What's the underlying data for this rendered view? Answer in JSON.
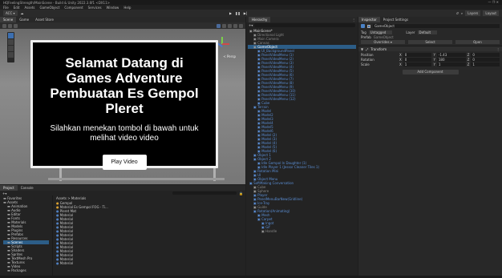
{
  "window": {
    "title": "HQFeelingStrength/MainScene - Build & Unity 2022.3.6f1 <DX11>"
  },
  "menu": [
    "File",
    "Edit",
    "Assets",
    "GameObject",
    "Component",
    "Services",
    "Window",
    "Help"
  ],
  "toolbar": {
    "account": "ACC ▾",
    "layers": "Layers",
    "layout": "Layout"
  },
  "scene_panel": {
    "tabs": [
      "Scene",
      "Game",
      "Asset Store"
    ],
    "persp_label": "< Persp"
  },
  "game_ui": {
    "title": "Selamat Datang di Games Adventure Pembuatan Es Gempol Pleret",
    "body": "Silahkan menekan tombol di bawah untuk melihat video video",
    "button": "Play Video"
  },
  "hierarchy": {
    "tab": "Hierarchy",
    "items": [
      {
        "label": "MainScene*",
        "indent": 0,
        "style": "bold"
      },
      {
        "label": "Directional Light",
        "indent": 1,
        "style": "dim"
      },
      {
        "label": "Main Camera",
        "indent": 1,
        "style": "dim"
      },
      {
        "label": "Canvas",
        "indent": 1,
        "style": "dim"
      },
      {
        "label": "GameObject",
        "indent": 1,
        "style": "sel"
      },
      {
        "label": "UI_BackgroundPanel",
        "indent": 2,
        "style": "hl"
      },
      {
        "label": "PanelVideoMenu (1)",
        "indent": 2,
        "style": "hl"
      },
      {
        "label": "PanelVideoMenu (2)",
        "indent": 2,
        "style": "hl"
      },
      {
        "label": "PanelVideoMenu (3)",
        "indent": 2,
        "style": "hl"
      },
      {
        "label": "PanelVideoMenu (4)",
        "indent": 2,
        "style": "hl"
      },
      {
        "label": "PanelVideoMenu (5)",
        "indent": 2,
        "style": "hl"
      },
      {
        "label": "PanelVideoMenu (6)",
        "indent": 2,
        "style": "hl"
      },
      {
        "label": "PanelVideoMenu (7)",
        "indent": 2,
        "style": "hl"
      },
      {
        "label": "PanelVideoMenu (8)",
        "indent": 2,
        "style": "hl"
      },
      {
        "label": "PanelVideoMenu (9)",
        "indent": 2,
        "style": "hl"
      },
      {
        "label": "PanelVideoMenu (10)",
        "indent": 2,
        "style": "hl"
      },
      {
        "label": "PanelVideoMenu (11)",
        "indent": 2,
        "style": "hl"
      },
      {
        "label": "PanelVideoMenu (12)",
        "indent": 2,
        "style": "hl"
      },
      {
        "label": "Cube",
        "indent": 2,
        "style": "hl"
      },
      {
        "label": "Terrain",
        "indent": 1,
        "style": "hl"
      },
      {
        "label": "Model",
        "indent": 2,
        "style": "hl"
      },
      {
        "label": "Model2",
        "indent": 2,
        "style": "hl"
      },
      {
        "label": "Model3",
        "indent": 2,
        "style": "hl"
      },
      {
        "label": "Model4",
        "indent": 2,
        "style": "hl"
      },
      {
        "label": "Model5",
        "indent": 2,
        "style": "hl"
      },
      {
        "label": "Model6",
        "indent": 2,
        "style": "hl"
      },
      {
        "label": "Model (2)",
        "indent": 2,
        "style": "hl"
      },
      {
        "label": "Model (3)",
        "indent": 2,
        "style": "hl"
      },
      {
        "label": "Model (4)",
        "indent": 2,
        "style": "hl"
      },
      {
        "label": "Model (5)",
        "indent": 2,
        "style": "hl"
      },
      {
        "label": "Model (6)",
        "indent": 2,
        "style": "hl"
      },
      {
        "label": "Object 1",
        "indent": 1,
        "style": "hl"
      },
      {
        "label": "Object 2",
        "indent": 1,
        "style": "hl"
      },
      {
        "label": "Idle Gempol In Daughter (1)",
        "indent": 2,
        "style": "hl"
      },
      {
        "label": "Idle Player 1 (Jessor Cleaner Tiles 1)",
        "indent": 2,
        "style": "hl"
      },
      {
        "label": "Rotation Mini",
        "indent": 1,
        "style": "hl"
      },
      {
        "label": "UI",
        "indent": 1,
        "style": "hl"
      },
      {
        "label": "Object Menu",
        "indent": 1,
        "style": "hl"
      },
      {
        "label": "SoftMaking Conversation",
        "indent": 0,
        "style": "hl"
      },
      {
        "label": "Cube",
        "indent": 1,
        "style": "dim"
      },
      {
        "label": "Sphere",
        "indent": 1,
        "style": "dim"
      },
      {
        "label": "Player",
        "indent": 1,
        "style": "hl"
      },
      {
        "label": "PanelMenuBarNew(Gridline)",
        "indent": 1,
        "style": "hl"
      },
      {
        "label": "Ice-Tray",
        "indent": 1,
        "style": "hl"
      },
      {
        "label": "Guide",
        "indent": 1,
        "style": "dim"
      },
      {
        "label": "Rotation(Animating)",
        "indent": 1,
        "style": "hl"
      },
      {
        "label": "Mesh",
        "indent": 2,
        "style": "hl"
      },
      {
        "label": "Carpet",
        "indent": 2,
        "style": "hl"
      },
      {
        "label": "Ingot",
        "indent": 3,
        "style": "hl"
      },
      {
        "label": "Gif",
        "indent": 3,
        "style": "hl"
      },
      {
        "label": "Handle",
        "indent": 3,
        "style": "dim"
      }
    ]
  },
  "inspector": {
    "tabs": [
      "Inspector",
      "Project Settings"
    ],
    "object_name": "GameObject",
    "tag_label": "Tag",
    "tag_value": "Untagged",
    "layer_label": "Layer",
    "layer_value": "Default",
    "prefab_label": "Prefab",
    "prefab_value": "GameObject",
    "prefab_buttons": [
      "Overrides ▾",
      "Select",
      "Open"
    ],
    "component": "Transform",
    "fields": [
      {
        "label": "Position",
        "x": "0",
        "y": "-1.43",
        "z": "0"
      },
      {
        "label": "Rotation",
        "x": "0",
        "y": "180",
        "z": "0"
      },
      {
        "label": "Scale",
        "x": "1",
        "y": "1",
        "z": "1"
      }
    ],
    "add_component": "Add Component"
  },
  "project": {
    "tabs": [
      "Project",
      "Console"
    ],
    "tree": [
      "Favorites",
      "Assets",
      "Animation",
      "Audio",
      "Editor",
      "Fonts",
      "Materials",
      "Models",
      "Plugins",
      "Prefabs",
      "Resources",
      "Scenes",
      "Scripts",
      "Shaders",
      "Sprites",
      "TextMesh Pro",
      "Textures",
      "Video",
      "Packages"
    ],
    "breadcrumb": "Assets > Materials",
    "files": [
      "Gempol",
      "Material Es Gempol FOG - Ti...",
      "Pleret Mat",
      "Material",
      "Material",
      "Material",
      "Material",
      "Material",
      "Material",
      "Material",
      "Material",
      "Material",
      "Material",
      "Material",
      "Material",
      "Material"
    ]
  }
}
